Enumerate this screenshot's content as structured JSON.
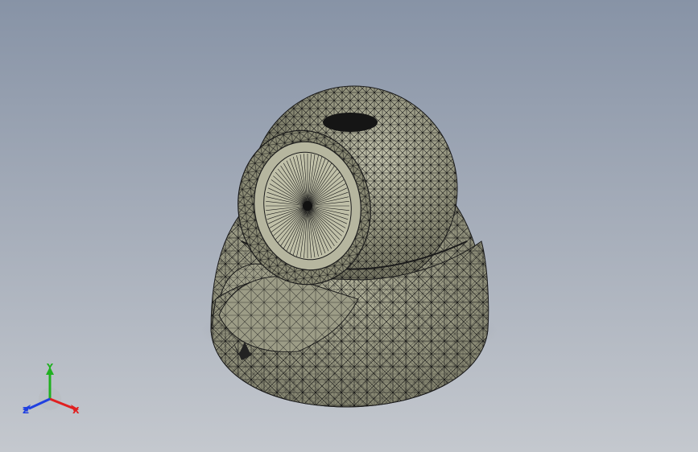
{
  "viewport": {
    "background_top": "#8793a6",
    "background_bottom": "#c4c8ce"
  },
  "model": {
    "shading_color": "#9a9a84",
    "mesh_line_color": "#111111",
    "display_mode": "shaded-with-mesh-triangles"
  },
  "triad": {
    "x_label": "X",
    "y_label": "Y",
    "z_label": "Z",
    "x_color": "#e02020",
    "y_color": "#20b020",
    "z_color": "#2040e0"
  }
}
